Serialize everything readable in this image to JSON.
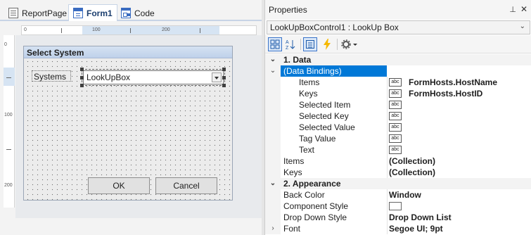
{
  "designer": {
    "tabs": [
      {
        "label": "ReportPage",
        "icon": "page-icon"
      },
      {
        "label": "Form1",
        "icon": "form-icon"
      },
      {
        "label": "Code",
        "icon": "code-icon"
      }
    ],
    "ruler_h": [
      "0",
      "100",
      "200"
    ],
    "ruler_v": [
      "0",
      "100",
      "200"
    ],
    "form": {
      "title": "Select System",
      "label": "Systems",
      "lookup_text": "LookUpBox",
      "ok": "OK",
      "cancel": "Cancel"
    }
  },
  "properties": {
    "title": "Properties",
    "pin_icon": "pin-icon",
    "close_icon": "close-icon",
    "object": "LookUpBoxControl1 : LookUp Box",
    "toolbar_icons": [
      "categorized-icon",
      "alphabetical-icon",
      "properties-icon",
      "events-icon",
      "settings-icon"
    ],
    "rows": [
      {
        "kind": "cat",
        "gut": "⌄",
        "name": "1. Data"
      },
      {
        "kind": "selected",
        "gut": "⌄",
        "name": "(Data Bindings)"
      },
      {
        "kind": "sub",
        "name": "Items",
        "abc": "abc",
        "value": "FormHosts.HostName"
      },
      {
        "kind": "sub",
        "name": "Keys",
        "abc": "abc",
        "value": "FormHosts.HostID"
      },
      {
        "kind": "sub",
        "name": "Selected Item",
        "abc": "abc",
        "value": ""
      },
      {
        "kind": "sub",
        "name": "Selected Key",
        "abc": "abc",
        "value": ""
      },
      {
        "kind": "sub",
        "name": "Selected Value",
        "abc": "abc",
        "value": ""
      },
      {
        "kind": "sub",
        "name": "Tag Value",
        "abc": "abc",
        "value": ""
      },
      {
        "kind": "sub",
        "name": "Text",
        "abc": "abc",
        "value": ""
      },
      {
        "kind": "prop",
        "name": "Items",
        "value": "(Collection)"
      },
      {
        "kind": "prop",
        "name": "Keys",
        "value": "(Collection)"
      },
      {
        "kind": "cat",
        "gut": "⌄",
        "name": "2. Appearance"
      },
      {
        "kind": "prop",
        "name": "Back Color",
        "value": "Window"
      },
      {
        "kind": "swatch",
        "name": "Component Style",
        "value": ""
      },
      {
        "kind": "prop",
        "name": "Drop Down Style",
        "value": "Drop Down List"
      },
      {
        "kind": "prop",
        "gut": "›",
        "name": "Font",
        "value": "Segoe UI; 9pt"
      }
    ]
  }
}
